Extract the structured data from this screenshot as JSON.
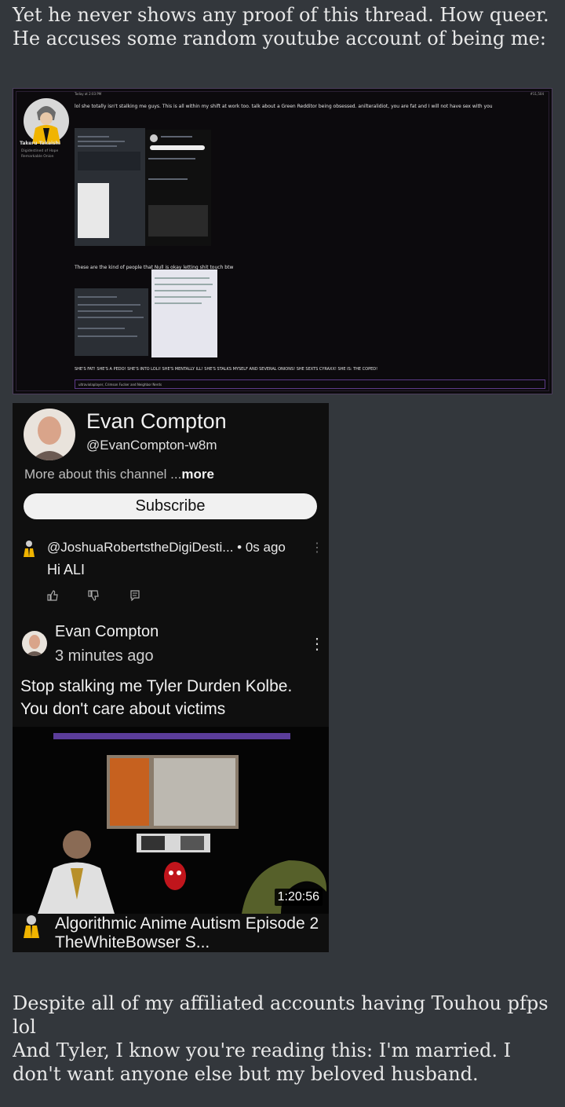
{
  "post": {
    "intro_lines": [
      "Yet he never shows any proof of this thread. How queer.",
      "He accuses some random youtube account of being me:"
    ],
    "outro_lines": [
      "Despite all of my affiliated accounts having Touhou pfps lol",
      "And Tyler, I know you're reading this: I'm married. I don't want anyone else but my beloved husband."
    ]
  },
  "forum_screenshot": {
    "username": "Takeru Takaishi",
    "user_title_lines": [
      "Digidestined of Hope",
      "Remarkable Onion"
    ],
    "date": "Today at 2:03 PM",
    "post_number": "#11,504",
    "body": "lol she totally isn't stalking me guys. This is all within my shift at work too. talk about a Green Redditor being obsessed. anilteralidiot, you are fat and I will not have sex with you",
    "middle_text": "These are the kind of people that Null is okay letting shit touch btw",
    "bottom_text": "SHE'S FAT! SHE'S A PEDO! SHE'S INTO LOLI! SHE'S MENTALLY ILL! SHE'S STALKS MYSELF AND SEVERAL ONIONS! SHE SEXTS CYRAXX! SHE IS: THE COPED!",
    "signature": "ultraviolaplayer, Crimson Fucker and Neighbor Nerds"
  },
  "youtube": {
    "channel_name": "Evan Compton",
    "handle": "@EvanCompton-w8m",
    "more_about": "More about this channel ...",
    "more_link": "more",
    "subscribe_label": "Subscribe",
    "comment1": {
      "author": "@JoshuaRobertstheDigiDesti...",
      "time": "• 0s ago",
      "text": "Hi ALI"
    },
    "comment2": {
      "author": "Evan Compton",
      "time": "3 minutes ago",
      "text_lines": [
        "Stop stalking me Tyler Durden Kolbe.",
        "You don't care about victims"
      ]
    },
    "video": {
      "duration": "1:20:56",
      "title": "Algorithmic Anime Autism Episode 2 TheWhiteBowser S..."
    },
    "icons": [
      "like-icon",
      "dislike-icon",
      "reply-icon",
      "more-vert-icon"
    ]
  }
}
